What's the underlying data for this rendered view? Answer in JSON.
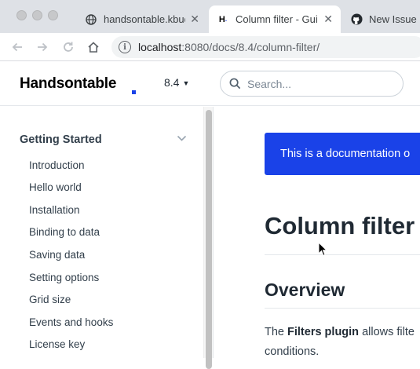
{
  "browser": {
    "tabs": [
      {
        "title": "handsontable.kbud",
        "favicon": "globe-icon"
      },
      {
        "title": "Column filter - Gui",
        "favicon": "handsontable-h-icon",
        "active": true
      },
      {
        "title": "New Issue ·",
        "favicon": "github-icon"
      }
    ],
    "url_host": "localhost",
    "url_path": ":8080/docs/8.4/column-filter/"
  },
  "header": {
    "logo": "Handsontable",
    "version": "8.4",
    "search_placeholder": "Search..."
  },
  "sidebar": {
    "section": "Getting Started",
    "items": [
      "Introduction",
      "Hello world",
      "Installation",
      "Binding to data",
      "Saving data",
      "Setting options",
      "Grid size",
      "Events and hooks",
      "License key"
    ]
  },
  "content": {
    "banner": "This is a documentation o",
    "title": "Column filter",
    "subtitle": "Overview",
    "para_start": "The ",
    "para_bold": "Filters plugin",
    "para_rest": " allows filte",
    "para_line2": "conditions."
  },
  "colors": {
    "brand_blue": "#1a42e8",
    "text_dark": "#1f2933"
  }
}
